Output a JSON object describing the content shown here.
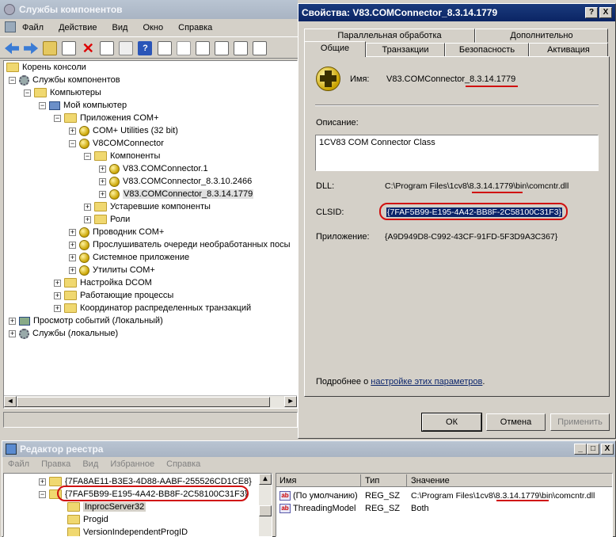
{
  "main_window": {
    "title": "Службы компонентов",
    "menu": [
      "Файл",
      "Действие",
      "Вид",
      "Окно",
      "Справка"
    ],
    "tree": [
      {
        "label": "Корень консоли"
      },
      {
        "label": "Службы компонентов"
      },
      {
        "label": "Компьютеры"
      },
      {
        "label": "Мой компьютер"
      },
      {
        "label": "Приложения COM+"
      },
      {
        "label": "COM+ Utilities (32 bit)"
      },
      {
        "label": "V8COMConnector"
      },
      {
        "label": "Компоненты"
      },
      {
        "label": "V83.COMConnector.1"
      },
      {
        "label": "V83.COMConnector_8.3.10.2466"
      },
      {
        "label": "V83.COMConnector_8.3.14.1779"
      },
      {
        "label": "Устаревшие компоненты"
      },
      {
        "label": "Роли"
      },
      {
        "label": "Проводник COM+"
      },
      {
        "label": "Прослушиватель очереди необработанных посы"
      },
      {
        "label": "Системное приложение"
      },
      {
        "label": "Утилиты COM+"
      },
      {
        "label": "Настройка DCOM"
      },
      {
        "label": "Работающие процессы"
      },
      {
        "label": "Координатор распределенных транзакций"
      },
      {
        "label": "Просмотр событий (Локальный)"
      },
      {
        "label": "Службы (локальные)"
      }
    ]
  },
  "dialog": {
    "title": "Свойства: V83.COMConnector_8.3.14.1779",
    "help_btn": "?",
    "close_btn": "X",
    "tabs_back": [
      "Параллельная обработка",
      "Дополнительно"
    ],
    "tabs_front": [
      "Общие",
      "Транзакции",
      "Безопасность",
      "Активация"
    ],
    "name_label": "Имя:",
    "name_value": "V83.COMConnector_8.3.14.1779",
    "description_label": "Описание:",
    "description_value": "1CV83 COM Connector Class",
    "dll_label": "DLL:",
    "dll_value": "C:\\Program Files\\1cv8\\8.3.14.1779\\bin\\comcntr.dll",
    "clsid_label": "CLSID:",
    "clsid_value": "{7FAF5B99-E195-4A42-BB8F-2C58100C31F3}",
    "app_label": "Приложение:",
    "app_value": "{A9D949D8-C992-43CF-91FD-5F3D9A3C367}",
    "more_text": "Подробнее о",
    "more_link": "настройке этих параметров",
    "more_dot": ".",
    "ok": "ОК",
    "cancel": "Отмена",
    "apply": "Применить"
  },
  "registry": {
    "title": "Редактор реестра",
    "menu": [
      "Файл",
      "Правка",
      "Вид",
      "Избранное",
      "Справка"
    ],
    "tree": [
      {
        "label": "{7FA8AE11-B3E3-4D88-AABF-255526CD1CE8}"
      },
      {
        "label": "{7FAF5B99-E195-4A42-BB8F-2C58100C31F3}"
      },
      {
        "label": "InprocServer32"
      },
      {
        "label": "Progid"
      },
      {
        "label": "VersionIndependentProgID"
      }
    ],
    "columns": [
      "Имя",
      "Тип",
      "Значение"
    ],
    "rows": [
      {
        "name": "(По умолчанию)",
        "type": "REG_SZ",
        "value": "C:\\Program Files\\1cv8\\8.3.14.1779\\bin\\comcntr.dll"
      },
      {
        "name": "ThreadingModel",
        "type": "REG_SZ",
        "value": "Both"
      }
    ]
  }
}
